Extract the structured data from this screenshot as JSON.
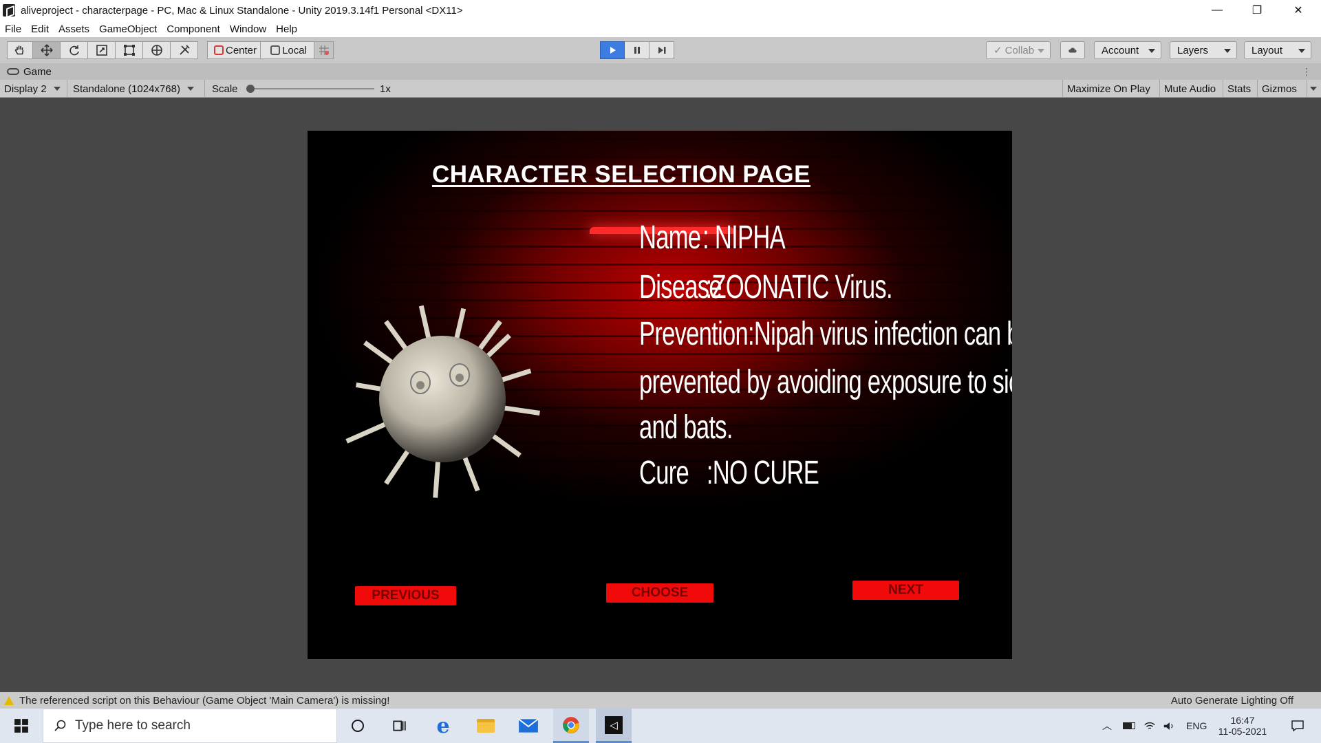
{
  "window": {
    "title": "aliveproject - characterpage - PC, Mac & Linux Standalone - Unity 2019.3.14f1 Personal <DX11>",
    "minimize": "—",
    "maximize": "❐",
    "close": "✕"
  },
  "menu": [
    "File",
    "Edit",
    "Assets",
    "GameObject",
    "Component",
    "Window",
    "Help"
  ],
  "toolbar": {
    "pivot_center": "Center",
    "pivot_local": "Local",
    "collab": "Collab",
    "account": "Account",
    "layers": "Layers",
    "layout": "Layout"
  },
  "game_tab": {
    "label": "Game"
  },
  "game_view": {
    "display": "Display 2",
    "resolution": "Standalone (1024x768)",
    "scale_label": "Scale",
    "scale_value": "1x",
    "maximize_on_play": "Maximize On Play",
    "mute_audio": "Mute Audio",
    "stats": "Stats",
    "gizmos": "Gizmos"
  },
  "game": {
    "page_title": "CHARACTER SELECTION PAGE",
    "name_label": "Name",
    "name_value": ": NIPHA",
    "disease_label": "Disease",
    "disease_value": ":ZOONATIC Virus.",
    "prevention_1": "Prevention:Nipah virus infection can be",
    "prevention_2": "prevented by avoiding exposure to sick pigs",
    "prevention_3": "and bats.",
    "cure_label": "Cure",
    "cure_value": ":NO CURE",
    "btn_previous": "PREVIOUS",
    "btn_choose": "CHOOSE",
    "btn_next": "NEXT"
  },
  "status": {
    "warning": "The referenced script on this Behaviour (Game Object 'Main Camera') is missing!",
    "lighting": "Auto Generate Lighting Off"
  },
  "taskbar": {
    "search_placeholder": "Type here to search",
    "language": "ENG",
    "time": "16:47",
    "date": "11-05-2021"
  },
  "colors": {
    "game_button": "#f00a0a",
    "play_active": "#3d7ce0",
    "spotlight": "#c80000"
  }
}
